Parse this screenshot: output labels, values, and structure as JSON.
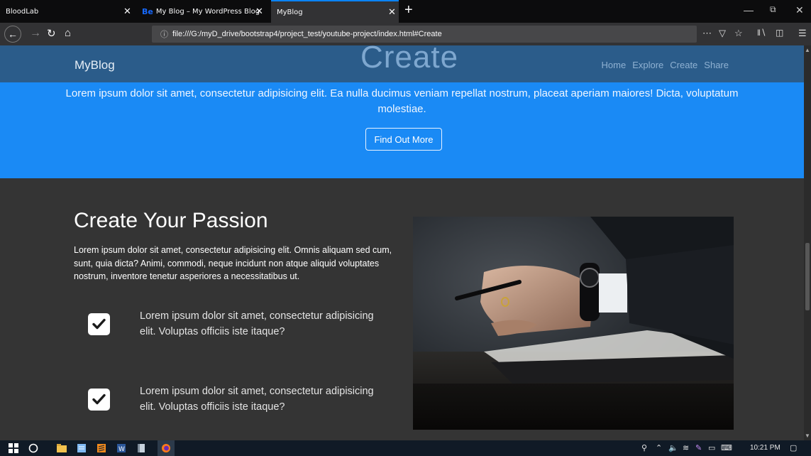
{
  "browser": {
    "tabs": [
      {
        "title": "BloodLab",
        "close": "✕"
      },
      {
        "badge": "Be",
        "title": "My Blog – My WordPress Blog",
        "close": "✕"
      },
      {
        "title": "MyBlog",
        "close": "✕"
      }
    ],
    "new_tab": "+",
    "url": "file:///G:/myD_drive/bootstrap4/project_test/youtube-project/index.html#Create"
  },
  "site": {
    "brand": "MyBlog",
    "section_title": "Create",
    "nav_links": [
      "Home",
      "Explore",
      "Create",
      "Share"
    ]
  },
  "hero": {
    "text": "Lorem ipsum dolor sit amet, consectetur adipisicing elit. Ea nulla ducimus veniam repellat nostrum, placeat aperiam maiores! Dicta, voluptatum molestiae.",
    "button": "Find Out More"
  },
  "passion": {
    "title": "Create Your Passion",
    "text": "Lorem ipsum dolor sit amet, consectetur adipisicing elit. Omnis aliquam sed cum, sunt, quia dicta? Animi, commodi, neque incidunt non atque aliquid voluptates nostrum, inventore tenetur asperiores a necessitatibus ut.",
    "features": [
      {
        "text": "Lorem ipsum dolor sit amet, consectetur adipisicing elit. Voluptas officiis iste itaque?"
      },
      {
        "text": "Lorem ipsum dolor sit amet, consectetur adipisicing elit. Voluptas officiis iste itaque?"
      }
    ]
  },
  "taskbar": {
    "clock": "10:21 PM"
  },
  "colors": {
    "hero_bg": "#1a8af5",
    "nav_bg": "#2b5c8a",
    "section_bg": "#343434"
  }
}
